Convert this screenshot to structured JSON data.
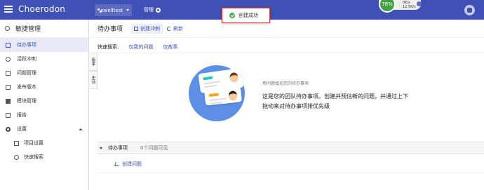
{
  "header": {
    "logo": "Choerodon",
    "project": "ewelltest",
    "manage": "管理",
    "toast": "创建成功",
    "network": {
      "percent": "78%",
      "up": "0K/s",
      "down": "12.5K/s"
    }
  },
  "sidebar": {
    "title": "敏捷管理",
    "items": [
      {
        "label": "待办事项"
      },
      {
        "label": "活跃冲刺"
      },
      {
        "label": "问题管理"
      },
      {
        "label": "发布版本"
      },
      {
        "label": "模块管理"
      },
      {
        "label": "报告"
      },
      {
        "label": "设置"
      },
      {
        "label": "项目设置"
      },
      {
        "label": "快速搜索"
      }
    ]
  },
  "vtabs": [
    "版本",
    "史诗"
  ],
  "main": {
    "title": "待办事项",
    "create_sprint": "创建冲刺",
    "refresh": "刷新",
    "quick_label": "快速搜索:",
    "quick_links": [
      "仅我的问题",
      "仅故事"
    ],
    "empty_hint": "用问题填充您的待办事项",
    "empty_main": "这是您的团队待办事项。创建并预估新的问题，并通过上下拖动来对待办事项排优先级",
    "backlog_title": "待办事项",
    "backlog_count": "0个问题可见",
    "create_issue": "创建问题"
  }
}
